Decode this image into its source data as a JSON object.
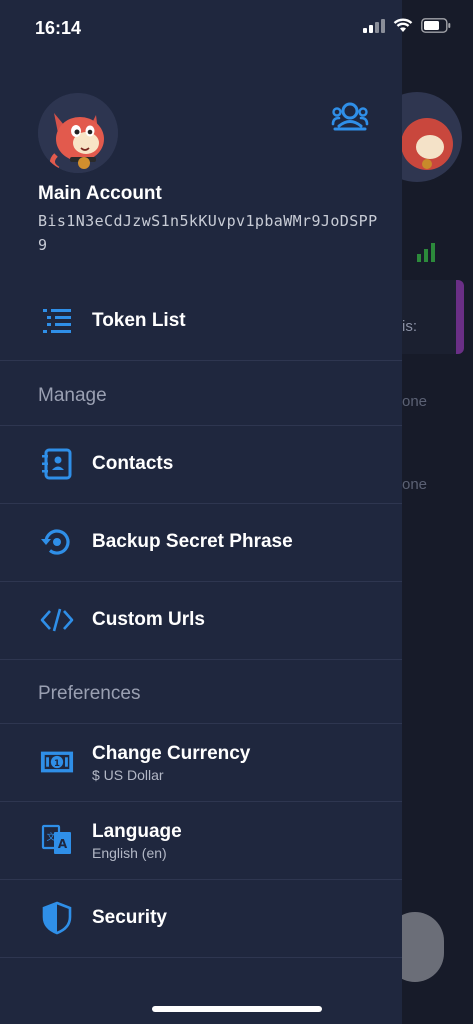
{
  "status_bar": {
    "time": "16:14"
  },
  "account": {
    "name": "Main Account",
    "address": "Bis1N3eCdJzwS1n5kKUvpv1pbaWMr9JoDSPP9"
  },
  "menu": {
    "token_list": "Token List",
    "manage_header": "Manage",
    "contacts": "Contacts",
    "backup": "Backup Secret Phrase",
    "custom_urls": "Custom Urls",
    "preferences_header": "Preferences",
    "currency": {
      "label": "Change Currency",
      "value": "$ US Dollar"
    },
    "language": {
      "label": "Language",
      "value": "English (en)"
    },
    "security": "Security"
  },
  "background": {
    "text_a": "is:",
    "text_b": "one",
    "text_c": "one"
  },
  "colors": {
    "drawer": "#1f273e",
    "accent": "#2f8fe8",
    "divider": "#2e3650"
  }
}
